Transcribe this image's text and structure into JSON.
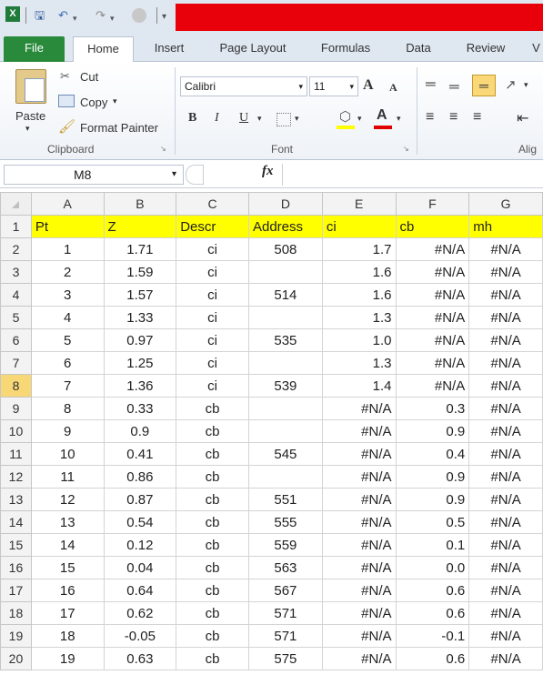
{
  "quick_access": {
    "excel_icon": "excel-icon",
    "save_icon": "save-icon",
    "undo_icon": "undo-icon",
    "redo_icon": "redo-icon"
  },
  "tabs": [
    "File",
    "Home",
    "Insert",
    "Page Layout",
    "Formulas",
    "Data",
    "Review",
    "V"
  ],
  "clipboard": {
    "paste": "Paste",
    "cut": "Cut",
    "copy": "Copy",
    "format_painter": "Format Painter",
    "group": "Clipboard"
  },
  "font": {
    "name": "Calibri",
    "size": "11",
    "group": "Font",
    "bold": "B",
    "italic": "I",
    "underline": "U",
    "grow": "A",
    "shrink": "A",
    "color": "A"
  },
  "alignment": {
    "group": "Alig"
  },
  "formula_bar": {
    "name_box": "M8",
    "fx": "fx",
    "value": ""
  },
  "columns": [
    "A",
    "B",
    "C",
    "D",
    "E",
    "F",
    "G"
  ],
  "selected_row": "8",
  "header_row": {
    "row": "1",
    "cells": [
      "Pt",
      "Z",
      "Descr",
      "Address",
      "ci",
      "cb",
      "mh"
    ]
  },
  "rows": [
    {
      "row": "2",
      "cells": [
        "1",
        "1.71",
        "ci",
        "508",
        "1.7",
        "#N/A",
        "#N/A"
      ]
    },
    {
      "row": "3",
      "cells": [
        "2",
        "1.59",
        "ci",
        "",
        "1.6",
        "#N/A",
        "#N/A"
      ]
    },
    {
      "row": "4",
      "cells": [
        "3",
        "1.57",
        "ci",
        "514",
        "1.6",
        "#N/A",
        "#N/A"
      ]
    },
    {
      "row": "5",
      "cells": [
        "4",
        "1.33",
        "ci",
        "",
        "1.3",
        "#N/A",
        "#N/A"
      ]
    },
    {
      "row": "6",
      "cells": [
        "5",
        "0.97",
        "ci",
        "535",
        "1.0",
        "#N/A",
        "#N/A"
      ]
    },
    {
      "row": "7",
      "cells": [
        "6",
        "1.25",
        "ci",
        "",
        "1.3",
        "#N/A",
        "#N/A"
      ]
    },
    {
      "row": "8",
      "cells": [
        "7",
        "1.36",
        "ci",
        "539",
        "1.4",
        "#N/A",
        "#N/A"
      ]
    },
    {
      "row": "9",
      "cells": [
        "8",
        "0.33",
        "cb",
        "",
        "#N/A",
        "0.3",
        "#N/A"
      ]
    },
    {
      "row": "10",
      "cells": [
        "9",
        "0.9",
        "cb",
        "",
        "#N/A",
        "0.9",
        "#N/A"
      ]
    },
    {
      "row": "11",
      "cells": [
        "10",
        "0.41",
        "cb",
        "545",
        "#N/A",
        "0.4",
        "#N/A"
      ]
    },
    {
      "row": "12",
      "cells": [
        "11",
        "0.86",
        "cb",
        "",
        "#N/A",
        "0.9",
        "#N/A"
      ]
    },
    {
      "row": "13",
      "cells": [
        "12",
        "0.87",
        "cb",
        "551",
        "#N/A",
        "0.9",
        "#N/A"
      ]
    },
    {
      "row": "14",
      "cells": [
        "13",
        "0.54",
        "cb",
        "555",
        "#N/A",
        "0.5",
        "#N/A"
      ]
    },
    {
      "row": "15",
      "cells": [
        "14",
        "0.12",
        "cb",
        "559",
        "#N/A",
        "0.1",
        "#N/A"
      ]
    },
    {
      "row": "16",
      "cells": [
        "15",
        "0.04",
        "cb",
        "563",
        "#N/A",
        "0.0",
        "#N/A"
      ]
    },
    {
      "row": "17",
      "cells": [
        "16",
        "0.64",
        "cb",
        "567",
        "#N/A",
        "0.6",
        "#N/A"
      ]
    },
    {
      "row": "18",
      "cells": [
        "17",
        "0.62",
        "cb",
        "571",
        "#N/A",
        "0.6",
        "#N/A"
      ]
    },
    {
      "row": "19",
      "cells": [
        "18",
        "-0.05",
        "cb",
        "571",
        "#N/A",
        "-0.1",
        "#N/A"
      ]
    },
    {
      "row": "20",
      "cells": [
        "19",
        "0.63",
        "cb",
        "575",
        "#N/A",
        "0.6",
        "#N/A"
      ]
    }
  ],
  "colors": {
    "header_fill": "#ffff00",
    "title_bar": "#e8000a",
    "file_tab": "#2a8a3b"
  }
}
